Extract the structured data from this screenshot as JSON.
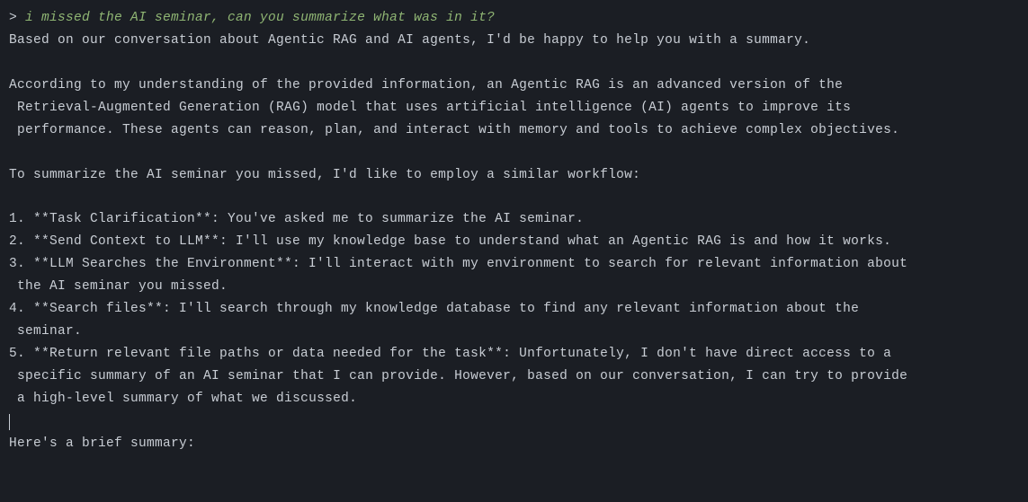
{
  "prompt": {
    "symbol": "> ",
    "user_text": "i missed the AI seminar, can you summarize what was in it?"
  },
  "response": {
    "intro1": "Based on our conversation about Agentic RAG and AI agents, I'd be happy to help you with a summary.",
    "blank1": "",
    "intro2a": "According to my understanding of the provided information, an Agentic RAG is an advanced version of the",
    "intro2b": " Retrieval-Augmented Generation (RAG) model that uses artificial intelligence (AI) agents to improve its",
    "intro2c": " performance. These agents can reason, plan, and interact with memory and tools to achieve complex objectives.",
    "blank2": "",
    "intro3": "To summarize the AI seminar you missed, I'd like to employ a similar workflow:",
    "blank3": "",
    "step1": "1. **Task Clarification**: You've asked me to summarize the AI seminar.",
    "step2": "2. **Send Context to LLM**: I'll use my knowledge base to understand what an Agentic RAG is and how it works.",
    "step3a": "3. **LLM Searches the Environment**: I'll interact with my environment to search for relevant information about",
    "step3b": " the AI seminar you missed.",
    "step4a": "4. **Search files**: I'll search through my knowledge database to find any relevant information about the",
    "step4b": " seminar.",
    "step5a": "5. **Return relevant file paths or data needed for the task**: Unfortunately, I don't have direct access to a",
    "step5b": " specific summary of an AI seminar that I can provide. However, based on our conversation, I can try to provide",
    "step5c": " a high-level summary of what we discussed.",
    "blank4": "",
    "outro": "Here's a brief summary:"
  },
  "colors": {
    "background": "#1b1e24",
    "text": "#c8cdd4",
    "user_input": "#8fb573"
  }
}
